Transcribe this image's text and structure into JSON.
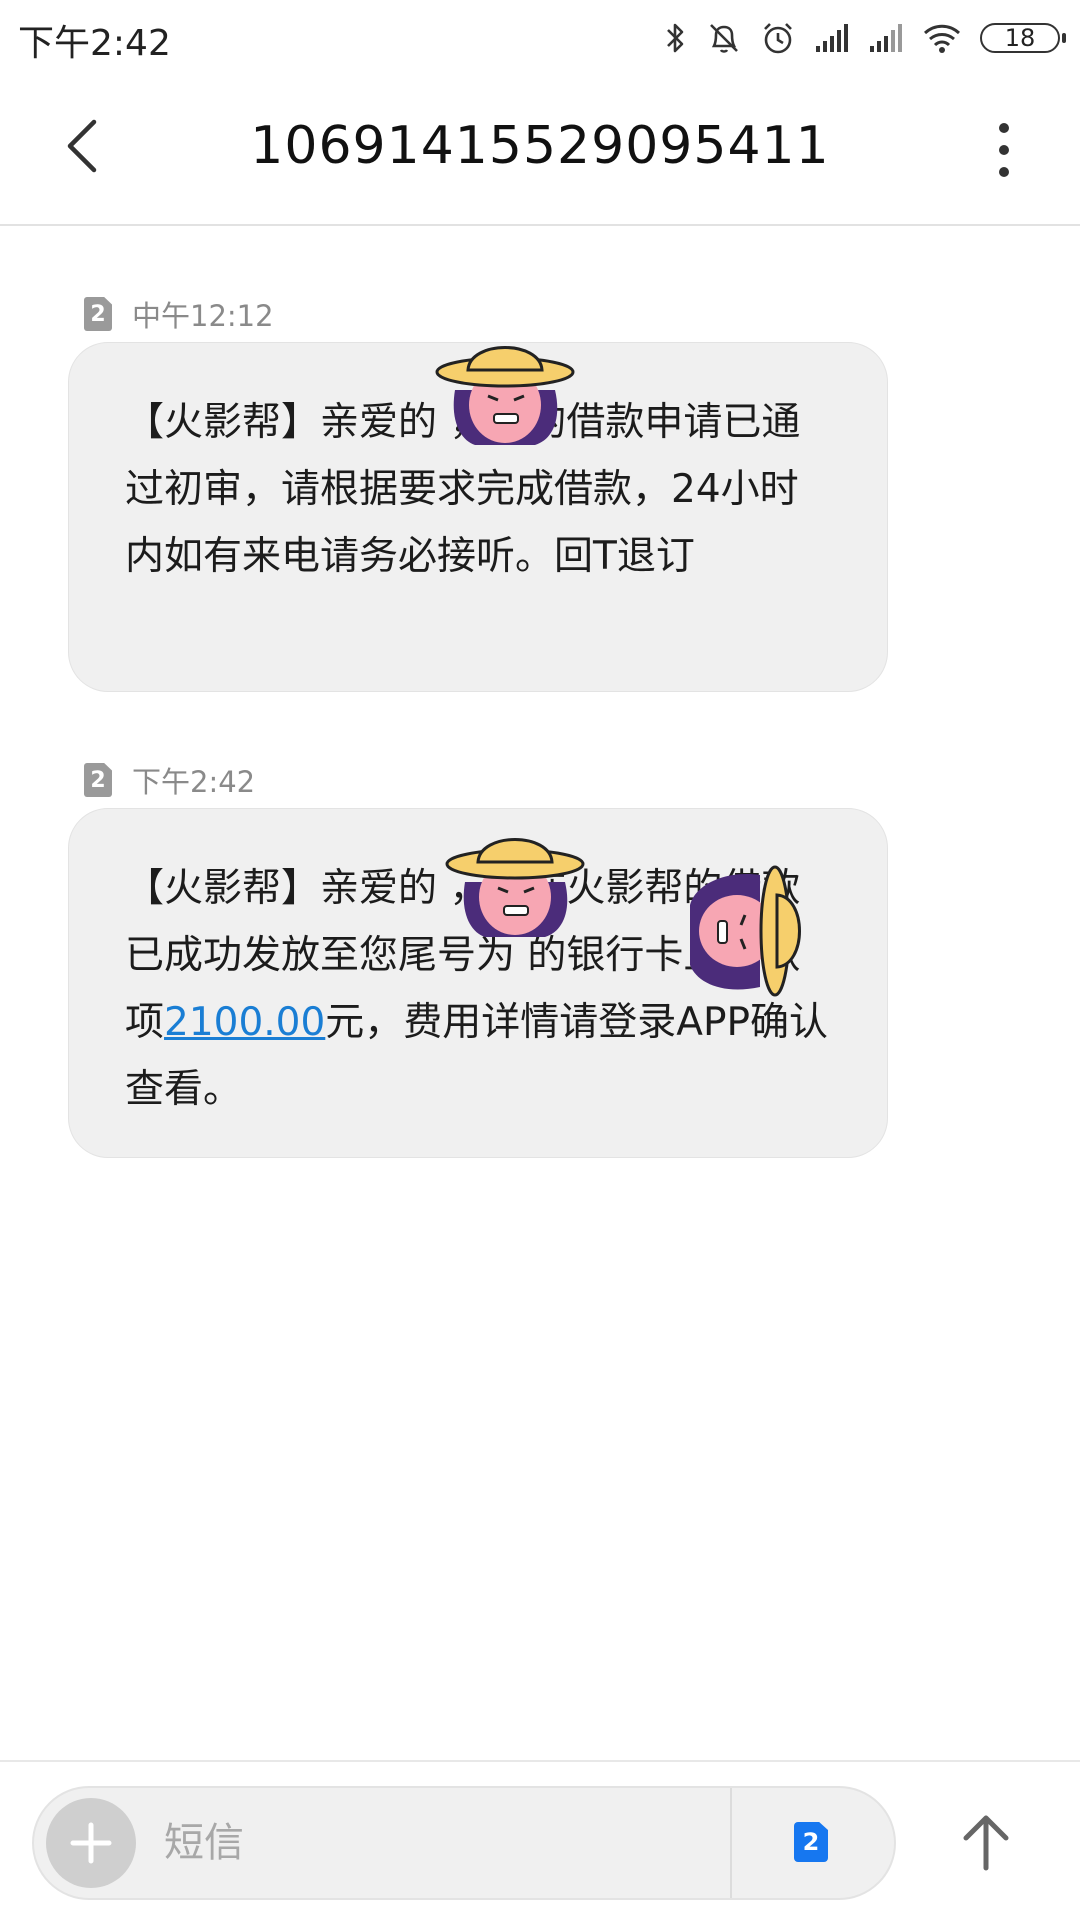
{
  "status_bar": {
    "time": "下午2:42",
    "battery": "18",
    "icons": [
      "bluetooth-icon",
      "mute-icon",
      "alarm-icon",
      "signal-icon",
      "signal-icon",
      "wifi-icon",
      "battery-icon"
    ]
  },
  "header": {
    "title": "10691415529095411",
    "back_icon": "chevron-left-icon",
    "menu_icon": "more-vertical-icon"
  },
  "messages": [
    {
      "sim": "2",
      "time": "中午12:12",
      "text": "【火影帮】亲爱的      ，您的借款申请已通过初审，请根据要求完成借款，24小时内如有来电请务必接听。回T退订"
    },
    {
      "sim": "2",
      "time": "下午2:42",
      "text_before": "【火影帮】亲爱的      ，您在火影帮的借款已成功发放至您尾号为     的银行卡上，款项",
      "amount": "2100.00",
      "text_after": "元，费用详情请登录APP确认查看。"
    }
  ],
  "composer": {
    "placeholder": "短信",
    "sim": "2",
    "add_icon": "plus-icon",
    "send_icon": "arrow-up-icon"
  },
  "colors": {
    "bubble": "#f0f0f0",
    "link": "#1a7ed4",
    "sim_active": "#1677f0",
    "sim_inactive": "#9a9a9a"
  }
}
